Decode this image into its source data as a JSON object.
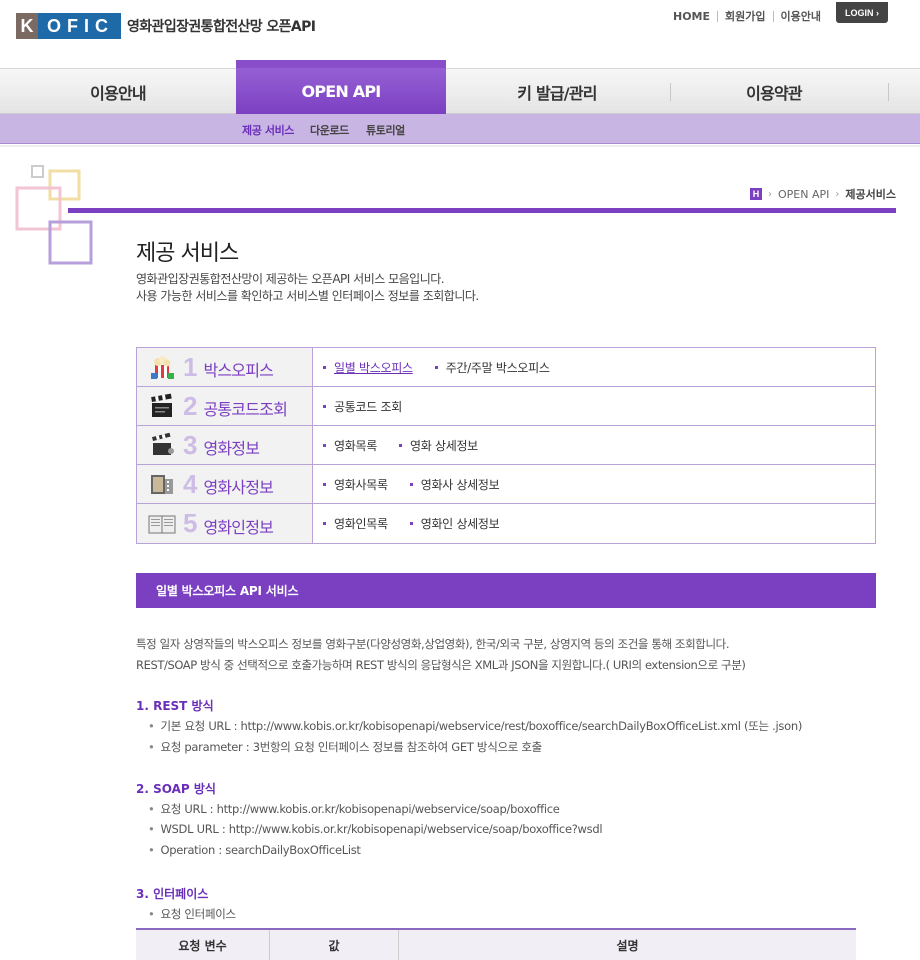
{
  "header": {
    "logo_letter": "K",
    "logo_rest": "OFIC",
    "site_title": "영화관입장권통합전산망 오픈API",
    "top_links": [
      "HOME",
      "회원가입",
      "이용안내"
    ],
    "login_label": "LOGIN ›"
  },
  "gnb": {
    "items": [
      "이용안내",
      "OPEN API",
      "키 발급/관리",
      "이용약관"
    ],
    "active_index": 1
  },
  "subnav": {
    "items": [
      "제공 서비스",
      "다운로드",
      "튜토리얼"
    ],
    "active_index": 0
  },
  "breadcrumb": {
    "home": "H",
    "level1": "OPEN API",
    "current": "제공서비스"
  },
  "page": {
    "title": "제공 서비스",
    "desc_line1": "영화관입장권통합전산망이  제공하는 오픈API 서비스 모음입니다.",
    "desc_line2": "사용 가능한 서비스를 확인하고 서비스별 인터페이스 정보를 조회합니다."
  },
  "services": [
    {
      "num": "1",
      "name": "박스오피스",
      "icon": "popcorn-icon",
      "links": [
        "일별 박스오피스",
        "주간/주말 박스오피스"
      ],
      "selected": 0
    },
    {
      "num": "2",
      "name": "공통코드조회",
      "icon": "clapperboard-icon",
      "links": [
        "공통코드 조회"
      ]
    },
    {
      "num": "3",
      "name": "영화정보",
      "icon": "film-clapper-icon",
      "links": [
        "영화목록",
        "영화 상세정보"
      ]
    },
    {
      "num": "4",
      "name": "영화사정보",
      "icon": "company-icon",
      "links": [
        "영화사목록",
        "영화사 상세정보"
      ]
    },
    {
      "num": "5",
      "name": "영화인정보",
      "icon": "book-icon",
      "links": [
        "영화인목록",
        "영화인 상세정보"
      ]
    }
  ],
  "section": {
    "title": "일별 박스오피스 API 서비스",
    "intro_line1": "특정 일자 상영작들의 박스오피스 정보를 영화구분(다양성영화,상업영화), 한국/외국 구분, 상영지역 등의 조건을 통해 조회합니다.",
    "intro_line2": "REST/SOAP 방식 중 선택적으로 호출가능하며 REST 방식의 응답형식은 XML과 JSON을 지원합니다.( URI의 extension으로 구분)",
    "rest_heading": "1. REST 방식",
    "rest_items": [
      "기본 요청 URL : http://www.kobis.or.kr/kobisopenapi/webservice/rest/boxoffice/searchDailyBoxOfficeList.xml (또는 .json)",
      "요청 parameter : 3번항의 요청 인터페이스 정보를 참조하여 GET 방식으로 호출"
    ],
    "soap_heading": "2. SOAP 방식",
    "soap_items": [
      "요청 URL : http://www.kobis.or.kr/kobisopenapi/webservice/soap/boxoffice",
      "WSDL URL : http://www.kobis.or.kr/kobisopenapi/webservice/soap/boxoffice?wsdl",
      "Operation : searchDailyBoxOfficeList"
    ],
    "iface_heading": "3. 인터페이스",
    "iface_items": [
      "요청 인터페이스"
    ],
    "iface_columns": [
      "요청 변수",
      "값",
      "설명"
    ]
  },
  "colors": {
    "accent": "#7b3fc2",
    "accent_light": "#c9b5e4",
    "border": "#b9a2d8"
  }
}
